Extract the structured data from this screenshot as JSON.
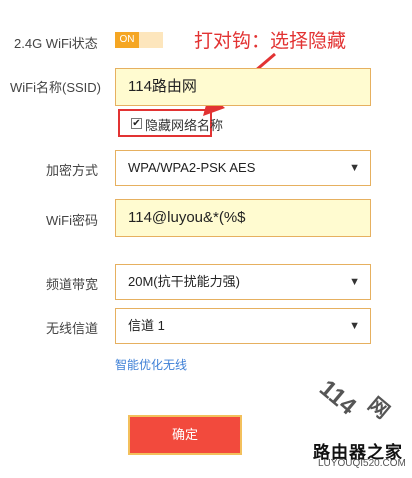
{
  "wifi_status": {
    "label": "2.4G WiFi状态",
    "toggle_text": "ON"
  },
  "annotation": {
    "text": "打对钩：选择隐藏"
  },
  "ssid": {
    "label": "WiFi名称(SSID)",
    "value": "114路由网"
  },
  "hide_network": {
    "label": "隐藏网络名称",
    "checked": true,
    "check_glyph": "✔"
  },
  "encryption": {
    "label": "加密方式",
    "value": "WPA/WPA2-PSK AES"
  },
  "password": {
    "label": "WiFi密码",
    "value": "114@luyou&*(%$"
  },
  "bandwidth": {
    "label": "频道带宽",
    "value": "20M(抗干扰能力强)"
  },
  "channel": {
    "label": "无线信道",
    "value": "信道 1"
  },
  "smart_optimize": {
    "label": "智能优化无线"
  },
  "confirm": {
    "label": "确定"
  },
  "watermark": {
    "line1": "114",
    "line2": "网",
    "line3": "路由器之家",
    "line4": "LUYOUQI520.COM"
  },
  "colors": {
    "accent": "#f5a623",
    "input_border": "#e6b060",
    "input_fill": "#fffbd0",
    "annotation_red": "#e23333",
    "confirm_red": "#f24a3d",
    "link_blue": "#3d7fd6"
  },
  "icons": {
    "dropdown": "chevron-down-icon",
    "checkbox": "checkmark-icon",
    "annotation_arrow": "arrow-icon"
  }
}
